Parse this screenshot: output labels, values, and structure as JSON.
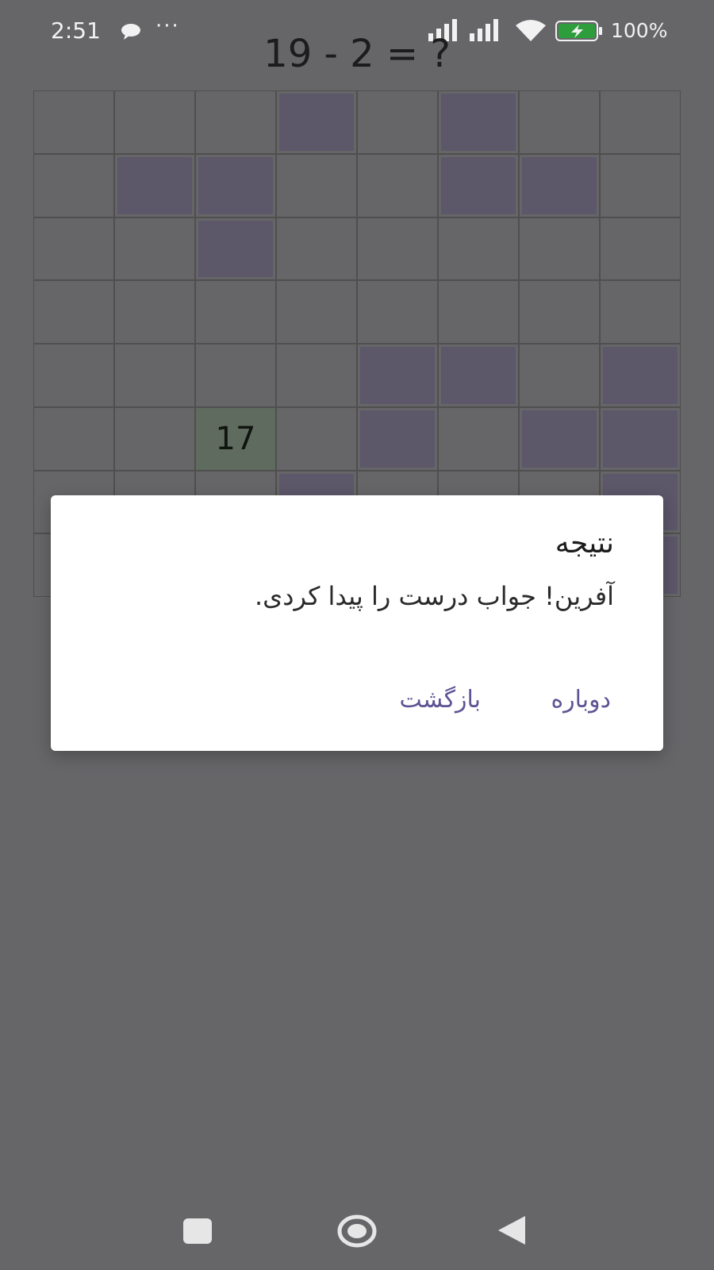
{
  "status_bar": {
    "time": "2:51",
    "overflow": "···",
    "battery_percent": "100%",
    "icons": [
      "chat-bubble-icon",
      "cell-signal-icon",
      "cell-signal-icon",
      "wifi-icon",
      "battery-charging-icon"
    ]
  },
  "game": {
    "equation": "19 - 2 = ?",
    "grid_rows": 8,
    "grid_cols": 8,
    "answer_cell_value": "17"
  },
  "dialog": {
    "title": "نتیجه",
    "message": "آفرین! جواب درست را پیدا کردی.",
    "again_label": "دوباره",
    "back_label": "بازگشت"
  },
  "nav_bar": {
    "icons": [
      "recent-apps-icon",
      "home-icon",
      "back-icon"
    ]
  },
  "colors": {
    "scrim": "#666568",
    "filled_cell": "#5c5769",
    "answer_cell": "#5f6b5e",
    "dialog_button": "#5e5493"
  }
}
